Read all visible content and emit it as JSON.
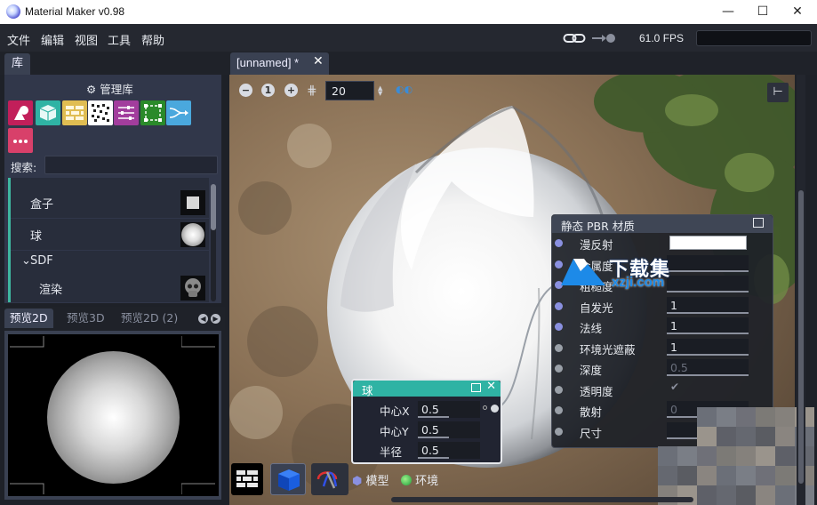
{
  "window": {
    "title": "Material Maker v0.98",
    "minimize": "—",
    "maximize": "☐",
    "close": "✕"
  },
  "menu": {
    "items": [
      "文件",
      "编辑",
      "视图",
      "工具",
      "帮助"
    ]
  },
  "status": {
    "fps": "61.0 FPS",
    "link_icon": "link-icon"
  },
  "library": {
    "tab": "库",
    "manage_label": "管理库",
    "categories": [
      {
        "icon": "shapes-icon",
        "color": "#c21f5a"
      },
      {
        "icon": "cube-icon",
        "color": "#2fb3a4"
      },
      {
        "icon": "bricks-icon",
        "color": "#e0bd52"
      },
      {
        "icon": "noise-icon",
        "color": "#ffffff"
      },
      {
        "icon": "sliders-icon",
        "color": "#a23d9d"
      },
      {
        "icon": "transform-icon",
        "color": "#2a8a2a"
      },
      {
        "icon": "flow-icon",
        "color": "#4aa8dd"
      },
      {
        "icon": "more-icon",
        "color": "#d8406a"
      }
    ],
    "search_label": "搜索:",
    "search_value": "",
    "tree": [
      {
        "label": "盒子",
        "indent": 2
      },
      {
        "label": "球",
        "indent": 2
      },
      {
        "label": "SDF",
        "indent": 1,
        "expanded": true
      },
      {
        "label": "渲染",
        "indent": 3
      }
    ]
  },
  "preview": {
    "tabs": [
      "预览2D",
      "预览3D",
      "预览2D (2)"
    ],
    "active_tab": 0
  },
  "editor": {
    "tab_label": "[unnamed] *",
    "tab_close": "✕",
    "snap_value": "20",
    "zoom_out": "−",
    "zoom_reset": "1",
    "zoom_in": "+"
  },
  "pbr_node": {
    "title": "静态 PBR 材质",
    "rows": [
      {
        "label": "漫反射",
        "value": "",
        "type": "color"
      },
      {
        "label": "金属度",
        "value": "",
        "type": "number"
      },
      {
        "label": "粗糙度",
        "value": "",
        "type": "number"
      },
      {
        "label": "自发光",
        "value": "1",
        "type": "number"
      },
      {
        "label": "法线",
        "value": "1",
        "type": "number"
      },
      {
        "label": "环境光遮蔽",
        "value": "1",
        "type": "number"
      },
      {
        "label": "深度",
        "value": "0.5",
        "type": "number"
      },
      {
        "label": "透明度",
        "value": "✔",
        "type": "check"
      },
      {
        "label": "散射",
        "value": "0",
        "type": "number"
      },
      {
        "label": "尺寸",
        "value": "",
        "type": "number"
      }
    ]
  },
  "sphere_node": {
    "title": "球",
    "rows": [
      {
        "label": "中心X",
        "value": "0.5"
      },
      {
        "label": "中心Y",
        "value": "0.5"
      },
      {
        "label": "半径",
        "value": "0.5"
      }
    ]
  },
  "bottom": {
    "model_label": "模型",
    "env_label": "环境"
  },
  "watermark": {
    "text": "下载集",
    "url": "xzji.com"
  }
}
